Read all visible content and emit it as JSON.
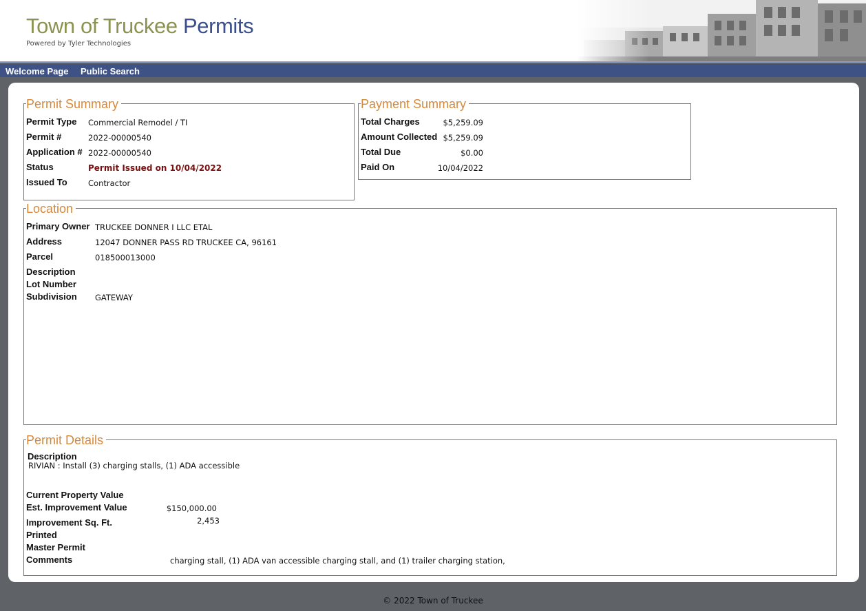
{
  "header": {
    "title_part1": "Town of Truckee",
    "title_part2": "Permits",
    "powered_by": "Powered by Tyler Technologies",
    "photo_icon": "town-street-photo"
  },
  "nav": {
    "welcome": "Welcome Page",
    "search": "Public Search"
  },
  "permit_summary": {
    "legend": "Permit Summary",
    "rows": [
      {
        "label": "Permit Type",
        "value": "Commercial Remodel / TI"
      },
      {
        "label": "Permit #",
        "value": "2022-00000540"
      },
      {
        "label": "Application #",
        "value": "2022-00000540"
      },
      {
        "label": "Status",
        "value": "Permit Issued on 10/04/2022"
      },
      {
        "label": "Issued To",
        "value": "Contractor"
      }
    ]
  },
  "payment_summary": {
    "legend": "Payment Summary",
    "rows": [
      {
        "label": "Total Charges",
        "value": "$5,259.09"
      },
      {
        "label": "Amount Collected",
        "value": "$5,259.09"
      },
      {
        "label": "Total Due",
        "value": "$0.00"
      },
      {
        "label": "Paid On",
        "value": "10/04/2022"
      }
    ]
  },
  "location": {
    "legend": "Location",
    "rows": [
      {
        "label": "Primary Owner",
        "value": "TRUCKEE DONNER I LLC ETAL"
      },
      {
        "label": "Address",
        "value": "12047 DONNER PASS RD TRUCKEE CA, 96161"
      },
      {
        "label": "Parcel",
        "value": "018500013000"
      },
      {
        "label": "Description",
        "value": ""
      },
      {
        "label": "Lot Number",
        "value": ""
      },
      {
        "label": "Subdivision",
        "value": "GATEWAY"
      }
    ]
  },
  "permit_details": {
    "legend": "Permit Details",
    "description_label": "Description",
    "description_value": "RIVIAN : Install (3) charging stalls, (1) ADA accessible",
    "rows": [
      {
        "label": "Current Property Value",
        "value": ""
      },
      {
        "label": "Est. Improvement Value",
        "value": "$150,000.00"
      },
      {
        "label": "Improvement Sq. Ft.",
        "value": "2,453"
      },
      {
        "label": "Printed",
        "value": ""
      },
      {
        "label": "Master Permit",
        "value": ""
      },
      {
        "label": "Comments",
        "value": "charging stall, (1) ADA van accessible charging stall, and (1) trailer charging station,"
      }
    ]
  },
  "footer": {
    "copyright": "© 2022 Town of Truckee"
  }
}
